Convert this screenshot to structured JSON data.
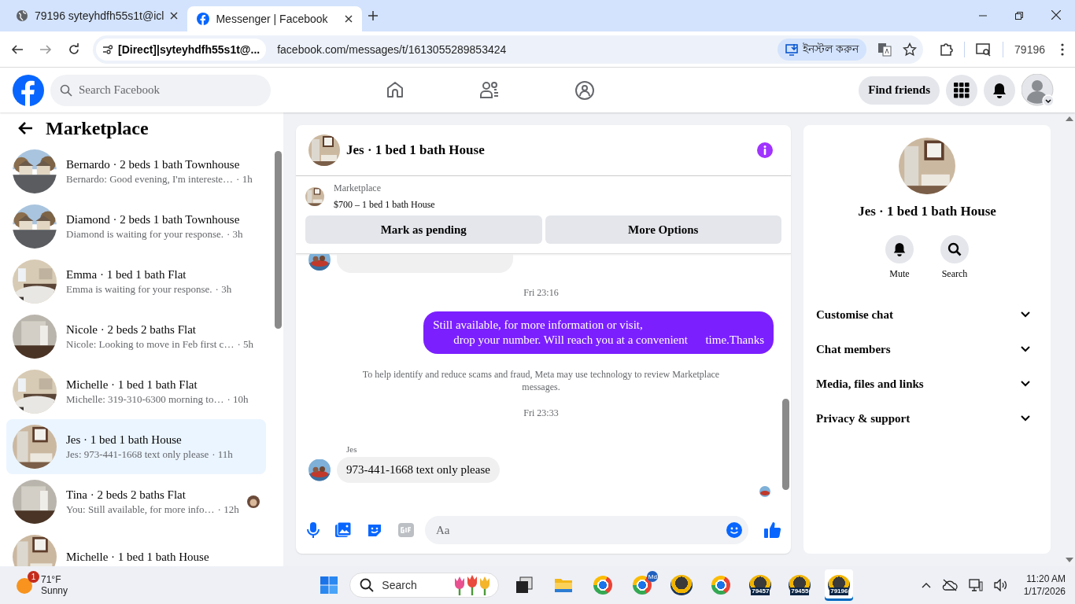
{
  "browser": {
    "tabs": [
      {
        "kind": "globe",
        "title": "79196 syteyhdfh55s1t@icl",
        "selected": false
      },
      {
        "kind": "facebook",
        "title": "Messenger | Facebook",
        "selected": true
      }
    ],
    "site_chip": "[Direct]|syteyhdfh55s1t@...",
    "url": "facebook.com/messages/t/1613055289853424",
    "install": "ইনস্টল করুন",
    "profile": "79196"
  },
  "header": {
    "search_placeholder": "Search Facebook",
    "find_friends": "Find friends"
  },
  "sidebar": {
    "title": "Marketplace",
    "conversations": [
      {
        "title": "Bernardo · 2 beds 1 bath Townhouse",
        "preview": "Bernardo: Good evening, I'm intereste…",
        "time": "· 1h",
        "selected": false,
        "seen": false
      },
      {
        "title": "Diamond · 2 beds 1 bath Townhouse",
        "preview": "Diamond is waiting for your response.",
        "time": "· 3h",
        "selected": false,
        "seen": false
      },
      {
        "title": "Emma · 1 bed 1 bath Flat",
        "preview": "Emma is waiting for your response.",
        "time": "· 3h",
        "selected": false,
        "seen": false
      },
      {
        "title": "Nicole · 2 beds 2 baths Flat",
        "preview": "Nicole: Looking to move in Feb first c…",
        "time": "· 5h",
        "selected": false,
        "seen": false
      },
      {
        "title": "Michelle · 1 bed 1 bath Flat",
        "preview": "Michelle: 319-310-6300 morning to…",
        "time": "· 10h",
        "selected": false,
        "seen": false
      },
      {
        "title": "Jes · 1 bed 1 bath House",
        "preview": "Jes: 973-441-1668 text only please",
        "time": "· 11h",
        "selected": true,
        "seen": false
      },
      {
        "title": "Tina · 2 beds 2 baths Flat",
        "preview": "You: Still available, for more info…",
        "time": "· 12h",
        "selected": false,
        "seen": true
      },
      {
        "title": "Michelle · 1 bed 1 bath House",
        "selected": false,
        "seen": false
      }
    ]
  },
  "chat": {
    "title": "Jes · 1 bed 1 bath House",
    "listing": {
      "label": "Marketplace",
      "price": "$700 – 1 bed 1 bath House"
    },
    "actions": [
      "Mark as pending",
      "More Options"
    ],
    "messages": [
      {
        "kind": "partial"
      },
      {
        "kind": "timestamp",
        "text": "Fri 23:16"
      },
      {
        "kind": "outgoing",
        "lines": [
          "Still available, for more information or visit,",
          "drop your number. Will reach you at a convenient      time.Thanks"
        ]
      },
      {
        "kind": "notice",
        "text": "To help identify and reduce scams and fraud, Meta may use technology to review Marketplace messages."
      },
      {
        "kind": "timestamp",
        "text": "Fri 23:33"
      },
      {
        "kind": "incoming",
        "sender": "Jes",
        "text": "973-441-1668 text only please",
        "seen": true
      }
    ],
    "composer": {
      "placeholder": "Aa"
    }
  },
  "details": {
    "name": "Jes · 1 bed 1 bath House",
    "actions": [
      {
        "kind": "bell",
        "label": "Mute"
      },
      {
        "kind": "search",
        "label": "Search"
      }
    ],
    "sections": [
      {
        "label": "Customise chat",
        "expanded": false
      },
      {
        "label": "Chat members",
        "expanded": false
      },
      {
        "label": "Media, files and links",
        "expanded": false
      },
      {
        "label": "Privacy & support",
        "expanded": false
      }
    ]
  },
  "taskbar": {
    "weather": {
      "temp": "71°F",
      "condition": "Sunny",
      "badge": "1"
    },
    "search": "Search",
    "apps": [
      {
        "kind": "task-view",
        "selected": false
      },
      {
        "kind": "folder",
        "selected": false
      },
      {
        "kind": "chrome",
        "selected": false
      },
      {
        "kind": "chrome",
        "badge": "Md",
        "selected": false
      },
      {
        "kind": "ix",
        "selected": false
      },
      {
        "kind": "chrome",
        "selected": false
      },
      {
        "kind": "ix",
        "label": "79457",
        "selected": false
      },
      {
        "kind": "ix",
        "label": "79455",
        "selected": false
      },
      {
        "kind": "ix",
        "label": "79196",
        "selected": true
      }
    ],
    "time": "11:20 AM",
    "date": "1/17/2026"
  }
}
